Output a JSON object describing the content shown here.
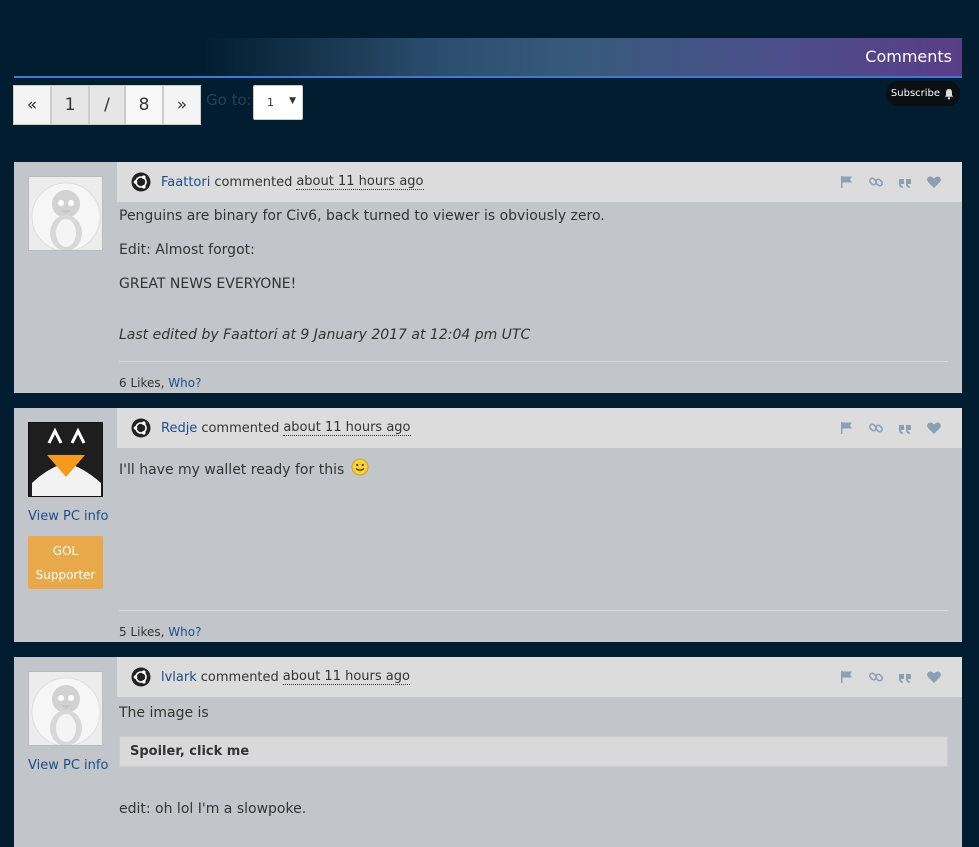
{
  "section": {
    "title": "Comments"
  },
  "pagination": {
    "prev": "«",
    "current": "1",
    "separator": "/",
    "total": "8",
    "next": "»",
    "goto_label": "Go to:",
    "goto_value": "1"
  },
  "subscribe": {
    "label": "Subscribe"
  },
  "comments": [
    {
      "user": "Faattori",
      "verb": "commented",
      "time": "about 11 hours ago",
      "paragraphs": [
        "Penguins are binary for Civ6, back turned to viewer is obviously zero.",
        "Edit: Almost forgot:",
        "GREAT NEWS EVERYONE!"
      ],
      "edited": "Last edited by Faattori at 9 January 2017 at 12:04 pm UTC",
      "likes": "6 Likes,",
      "who": "Who?"
    },
    {
      "user": "Redje",
      "verb": "commented",
      "time": "about 11 hours ago",
      "paragraphs": [
        "I'll have my wallet ready for this"
      ],
      "view_pc": "View PC info",
      "badge_line1": "GOL",
      "badge_line2": "Supporter",
      "likes": "5 Likes,",
      "who": "Who?"
    },
    {
      "user": "lvlark",
      "verb": "commented",
      "time": "about 11 hours ago",
      "paragraphs": [
        "The image is",
        "edit: oh lol I'm a slowpoke."
      ],
      "spoiler": "Spoiler, click me",
      "view_pc": "View PC info"
    }
  ],
  "colors": {
    "background": "#021d2f",
    "comment_bg": "#c2c6ca",
    "link": "#1b4e8a",
    "badge": "#e8a94a",
    "accent_line": "#3a7bd5"
  }
}
